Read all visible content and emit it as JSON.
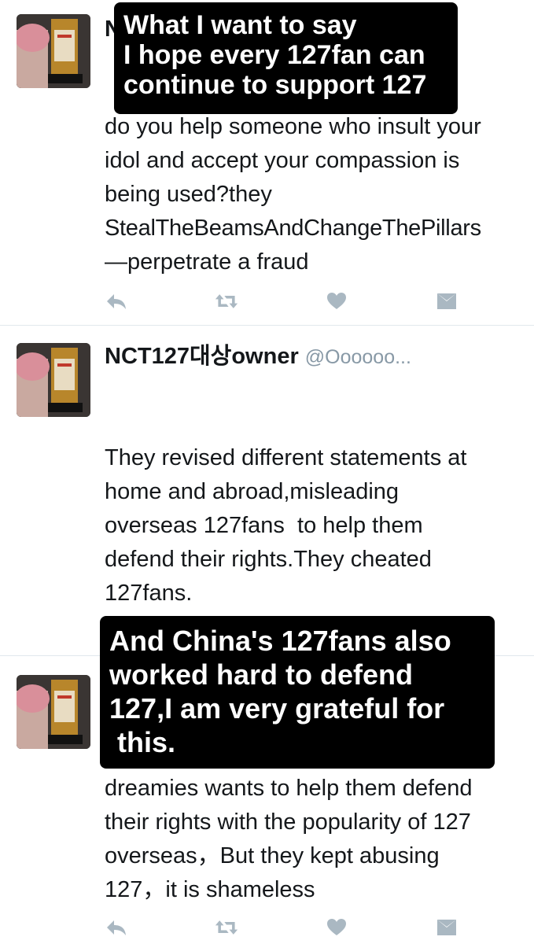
{
  "tweets": [
    {
      "display_name": "N",
      "handle": "",
      "body_lines": [
        "do you help someone who insult your",
        "idol and accept your compassion is",
        "being used?they",
        "StealTheBeamsAndChangeThePillars",
        "—perpetrate a fraud"
      ]
    },
    {
      "display_name": "NCT127대상owner",
      "handle": "@Oooooo...",
      "body_lines": [
        "They revised different statements at",
        "home and abroad,misleading",
        "overseas 127fans  to help them",
        "defend their rights.They cheated",
        "127fans."
      ]
    },
    {
      "display_name": "",
      "handle": "",
      "body_lines": [
        "dreamies wants to help them defend",
        "their rights with the popularity of 127",
        "overseas，But they kept abusing",
        "127，it is shameless"
      ]
    }
  ],
  "overlays": [
    {
      "lines": [
        "What I want to say",
        "I hope every 127fan can",
        "continue to support 127"
      ]
    },
    {
      "lines": [
        "And China's 127fans also",
        "worked hard to defend",
        "127,I am very grateful for",
        " this."
      ]
    }
  ],
  "icons": [
    "reply-icon",
    "retweet-icon",
    "like-icon",
    "message-icon"
  ],
  "colors": {
    "icon": "#aab8c2",
    "handle": "#8899a6",
    "divider": "#e1e8ed",
    "overlay_bg": "#000000",
    "overlay_text": "#ffffff"
  }
}
